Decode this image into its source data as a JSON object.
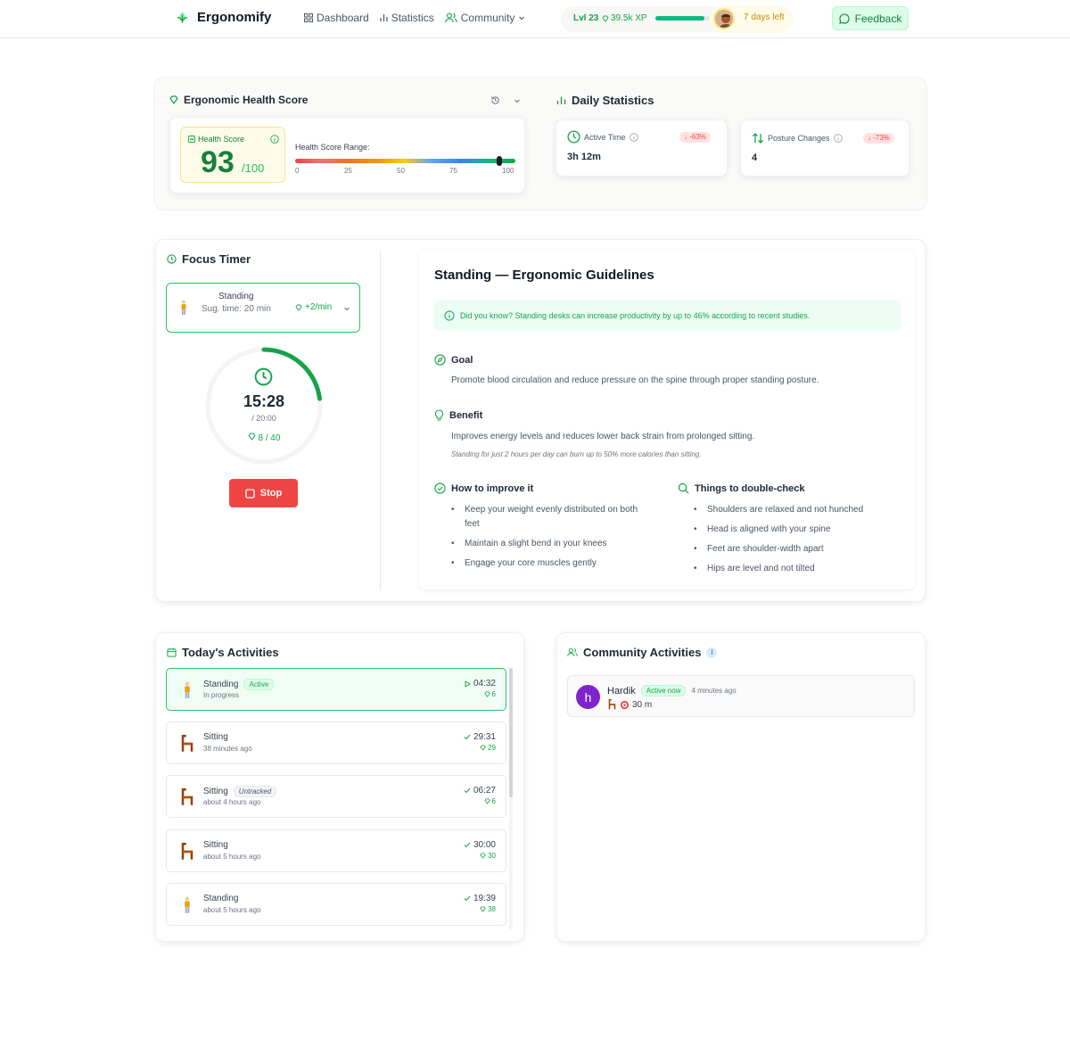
{
  "header": {
    "app_name": "Ergonomify",
    "nav": [
      {
        "label": "Dashboard",
        "icon": "grid-icon"
      },
      {
        "label": "Statistics",
        "icon": "bar-chart-icon"
      },
      {
        "label": "Community",
        "icon": "users-icon"
      }
    ],
    "level": "Lvl 23",
    "xp": "39.5k XP",
    "xp_progress": 0.88,
    "days_left": "7 days left",
    "feedback_label": "Feedback"
  },
  "health": {
    "title": "Ergonomic Health Score",
    "score_label": "Health Score",
    "score": "93",
    "score_max": "/100",
    "score_value": 93,
    "range_label": "Health Score Range:",
    "ticks": [
      "0",
      "25",
      "50",
      "75",
      "100"
    ]
  },
  "daily": {
    "title": "Daily Statistics",
    "active_time_label": "Active Time",
    "active_time_value": "3h 12m",
    "active_time_change": "-63%",
    "posture_label": "Posture Changes",
    "posture_value": "4",
    "posture_change": "-73%"
  },
  "focus": {
    "title": "Focus Timer",
    "mode": "Standing",
    "suggested": "Sug. time: 20 min",
    "rate": "+2/min",
    "time": "15:28",
    "total": "/ 20:00",
    "points": "8 / 40",
    "progress": 0.23,
    "stop_label": "Stop"
  },
  "guidelines": {
    "title": "Standing — Ergonomic Guidelines",
    "tip": "Did you know? Standing desks can increase productivity by up to 46% according to recent studies.",
    "goal_title": "Goal",
    "goal_text": "Promote blood circulation and reduce pressure on the spine through proper standing posture.",
    "benefit_title": "Benefit",
    "benefit_text": "Improves energy levels and reduces lower back strain from prolonged sitting.",
    "benefit_note": "Standing for just 2 hours per day can burn up to 50% more calories than sitting.",
    "improve_title": "How to improve it",
    "improve": [
      "Keep your weight evenly distributed on both feet",
      "Maintain a slight bend in your knees",
      "Engage your core muscles gently"
    ],
    "check_title": "Things to double-check",
    "check": [
      "Shoulders are relaxed and not hunched",
      "Head is aligned with your spine",
      "Feet are shoulder-width apart",
      "Hips are level and not tilted"
    ]
  },
  "activities": {
    "title": "Today's Activities",
    "items": [
      {
        "name": "Standing",
        "badge": "Active",
        "sub": "In progress",
        "time": "04:32",
        "pts": "6"
      },
      {
        "name": "Sitting",
        "badge": "",
        "sub": "38 minutes ago",
        "time": "29:31",
        "pts": "29"
      },
      {
        "name": "Sitting",
        "badge": "Untracked",
        "sub": "about 4 hours ago",
        "time": "06:27",
        "pts": "6"
      },
      {
        "name": "Sitting",
        "badge": "",
        "sub": "about 5 hours ago",
        "time": "30:00",
        "pts": "30"
      },
      {
        "name": "Standing",
        "badge": "",
        "sub": "about 5 hours ago",
        "time": "19:39",
        "pts": "38"
      }
    ]
  },
  "community": {
    "title": "Community Activities",
    "info": "i",
    "entry": {
      "initial": "h",
      "name": "Hardik",
      "status": "Active now",
      "ago": "4 minutes ago",
      "duration": "30 m"
    }
  },
  "colors": {
    "accent": "#16a34a",
    "danger": "#ef4444",
    "warn": "#ca8a04"
  }
}
